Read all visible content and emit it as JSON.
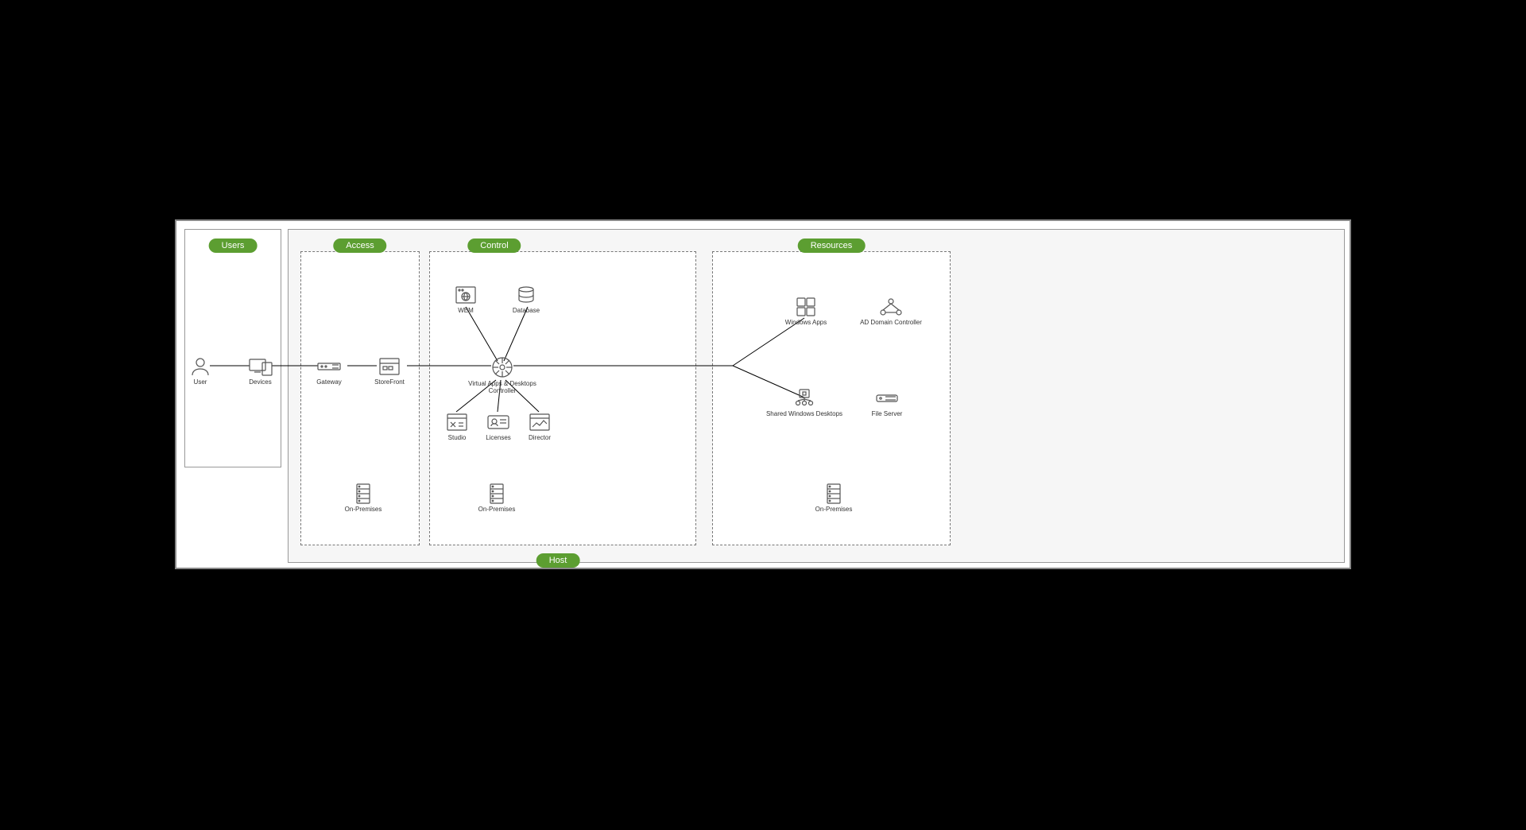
{
  "colors": {
    "accent": "#5c9e31",
    "icon": "#555555",
    "dash": "#777777",
    "panel": "#999999"
  },
  "sections": {
    "users": {
      "label": "Users"
    },
    "access": {
      "label": "Access"
    },
    "control": {
      "label": "Control"
    },
    "resources": {
      "label": "Resources"
    },
    "host": {
      "label": "Host"
    }
  },
  "nodes": {
    "user": {
      "label": "User"
    },
    "devices": {
      "label": "Devices"
    },
    "gateway": {
      "label": "Gateway"
    },
    "storefront": {
      "label": "StoreFront"
    },
    "wem": {
      "label": "WEM"
    },
    "database": {
      "label": "Database"
    },
    "controller": {
      "label": "Virtual Apps & Desktops Controller"
    },
    "studio": {
      "label": "Studio"
    },
    "licenses": {
      "label": "Licenses"
    },
    "director": {
      "label": "Director"
    },
    "winapps": {
      "label": "Windows Apps"
    },
    "adcontroller": {
      "label": "AD Domain Controller"
    },
    "shareddesk": {
      "label": "Shared Windows Desktops"
    },
    "fileserver": {
      "label": "File Server"
    },
    "onprem": {
      "label": "On-Premises"
    }
  }
}
